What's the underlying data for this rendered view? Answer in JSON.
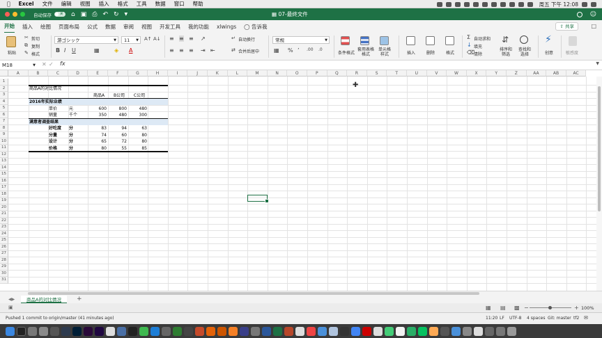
{
  "menubar": {
    "app": "Excel",
    "items": [
      "文件",
      "编辑",
      "视图",
      "插入",
      "格式",
      "工具",
      "数据",
      "窗口",
      "帮助"
    ],
    "clock": "周五 下午 12:08"
  },
  "titlebar": {
    "autosave_label": "自动保存",
    "autosave_state": "关闭",
    "document_title": "07-最终文件"
  },
  "ribbon_tabs": [
    "开始",
    "插入",
    "绘图",
    "页面布局",
    "公式",
    "数据",
    "审阅",
    "视图",
    "开发工具",
    "我的功能",
    "xlwings",
    "告诉我"
  ],
  "share_label": "共享",
  "ribbon": {
    "paste": "粘贴",
    "cut": "剪切",
    "copy": "复制",
    "format_painter": "格式",
    "font_name": "游ゴシック",
    "font_size": "11",
    "wrap_text": "自动换行",
    "merge_center": "合并后居中",
    "number_format": "常规",
    "conditional_format": "条件格式",
    "table_format": "套用表格格式",
    "cell_styles": "单元格样式",
    "insert": "插入",
    "delete": "删除",
    "format": "格式",
    "autosum": "自动求和",
    "fill": "填充",
    "clear": "清除",
    "sort_filter": "排序和筛选",
    "find_select": "查找和选择",
    "ideas": "创意",
    "sensitivity": "敏感度"
  },
  "formula_bar": {
    "name_box": "M18",
    "fx": "fx",
    "formula": ""
  },
  "columns": [
    "A",
    "B",
    "C",
    "D",
    "E",
    "F",
    "G",
    "H",
    "I",
    "J",
    "K",
    "L",
    "M",
    "N",
    "O",
    "P",
    "Q",
    "R",
    "S",
    "T",
    "U",
    "V",
    "W",
    "X",
    "Y",
    "Z",
    "AA",
    "AB",
    "AC"
  ],
  "rows": [
    "1",
    "2",
    "3",
    "4",
    "5",
    "6",
    "7",
    "8",
    "9",
    "10",
    "11",
    "12",
    "13",
    "14",
    "15",
    "16",
    "17",
    "18",
    "19",
    "20",
    "21",
    "22",
    "23",
    "24",
    "25",
    "26",
    "27",
    "28",
    "29",
    "30",
    "31"
  ],
  "sheet": {
    "title": "商品A的对比情况",
    "headers": [
      "商品A",
      "B公司",
      "C公司"
    ],
    "section1": "2016年实际业绩",
    "row_price": {
      "label": "单价",
      "unit": "元",
      "values": [
        "600",
        "800",
        "480"
      ]
    },
    "row_sales": {
      "label": "销量",
      "unit": "千个",
      "values": [
        "350",
        "480",
        "300"
      ]
    },
    "section2": "满意者调查结果",
    "survey": [
      {
        "label": "好吃度",
        "unit": "分",
        "values": [
          "83",
          "94",
          "63"
        ]
      },
      {
        "label": "分量",
        "unit": "分",
        "values": [
          "74",
          "60",
          "80"
        ]
      },
      {
        "label": "设计",
        "unit": "分",
        "values": [
          "65",
          "72",
          "80"
        ]
      },
      {
        "label": "价格",
        "unit": "分",
        "values": [
          "80",
          "55",
          "85"
        ]
      }
    ]
  },
  "sheet_tab": "商品A的对比情况",
  "status": {
    "zoom": "100%"
  },
  "gitbar": {
    "message": "Pushed 1 commit to origin/master (41 minutes ago)",
    "position": "11:20",
    "eol": "LF",
    "encoding": "UTF-8",
    "indent": "4 spaces",
    "branch": "Git: master",
    "extra": "tf2"
  },
  "colors": {
    "excel_green": "#1e7145",
    "band_blue": "#dde9f5"
  }
}
